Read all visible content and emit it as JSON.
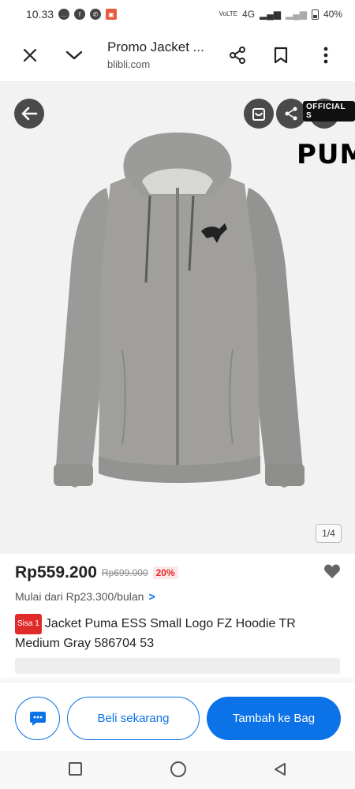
{
  "status_bar": {
    "time": "10.33",
    "network_small": "VoLTE",
    "network": "4G",
    "battery": "40%"
  },
  "toolbar": {
    "title": "Promo Jacket ...",
    "domain": "blibli.com",
    "icons": [
      "close-icon",
      "chevron-down-icon",
      "share-icon",
      "bookmark-icon",
      "more-vertical-icon"
    ]
  },
  "gallery": {
    "official_badge": "OFFICIAL S",
    "brand_text": "PUM",
    "image_counter": "1/4",
    "current_image": 1,
    "total_images": 4
  },
  "product": {
    "price": "Rp559.200",
    "old_price": "Rp699.000",
    "discount": "20%",
    "installment": "Mulai dari Rp23.300/bulan",
    "installment_arrow": ">",
    "stock_badge": "Sisa 1",
    "name": "Jacket Puma ESS Small Logo FZ Hoodie TR Medium Gray 586704 53"
  },
  "actions": {
    "buy_now": "Beli sekarang",
    "add_to_bag": "Tambah ke Bag"
  },
  "colors": {
    "primary": "#0b72e7",
    "discount": "#e02b2b",
    "jacket": "#9a9b98"
  }
}
